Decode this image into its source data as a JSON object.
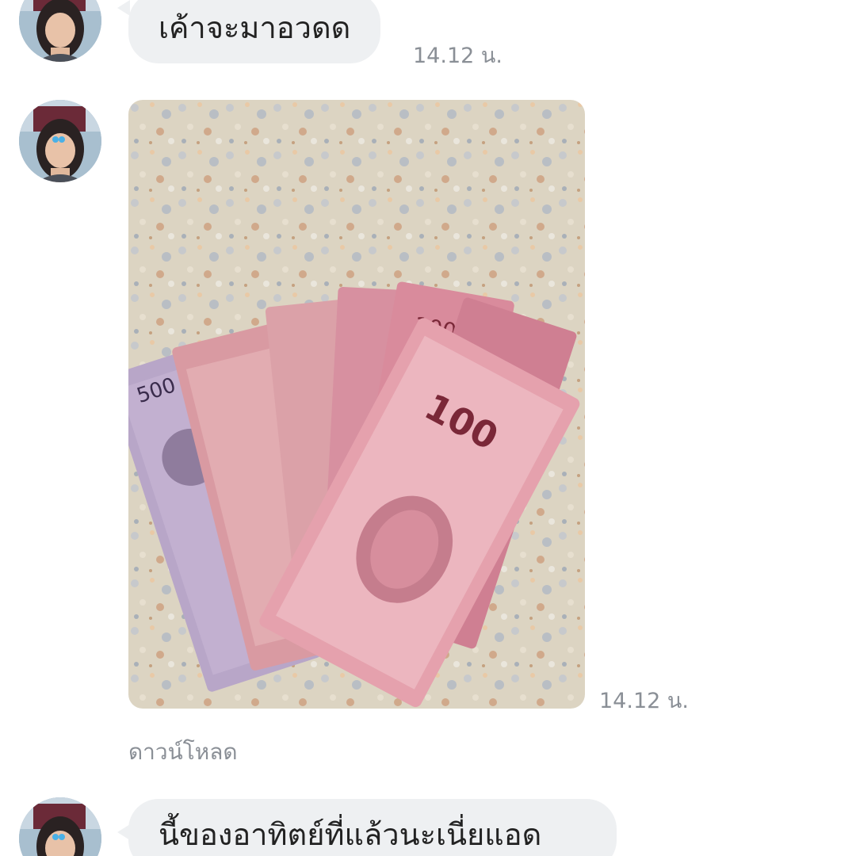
{
  "messages": [
    {
      "type": "text",
      "text": "เค้าจะมาอวดด",
      "time": "14.12 น."
    },
    {
      "type": "image",
      "time": "14.12 น.",
      "download_label": "ดาวน์โหลด",
      "banknote_labels": [
        "500",
        "1000",
        "100"
      ]
    },
    {
      "type": "text",
      "text": "นี้ของอาทิตย์ที่แล้วนะเนี่ยแอด"
    }
  ],
  "colors": {
    "bubble_bg": "#eef0f2",
    "bubble_text": "#222222",
    "meta_text": "#8a8f96",
    "page_bg": "#ffffff"
  },
  "icons": [
    "avatar"
  ]
}
